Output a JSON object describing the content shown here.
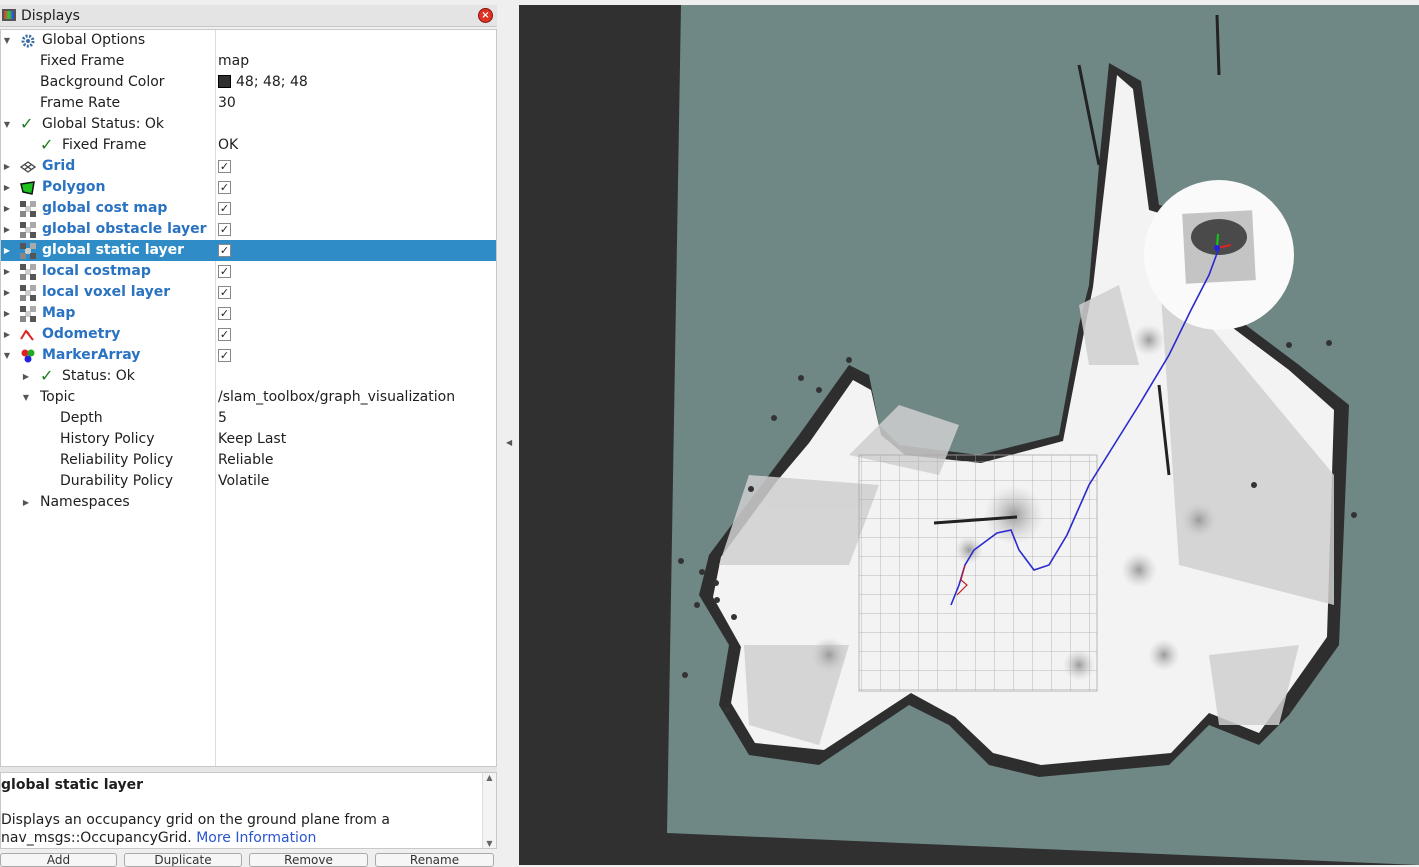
{
  "panel": {
    "title": "Displays",
    "close_label": "×"
  },
  "tree": {
    "global_options": {
      "label": "Global Options",
      "fixed_frame": {
        "label": "Fixed Frame",
        "value": "map"
      },
      "background_color": {
        "label": "Background Color",
        "value": "48; 48; 48",
        "color": "#303030"
      },
      "frame_rate": {
        "label": "Frame Rate",
        "value": "30"
      }
    },
    "global_status": {
      "label": "Global Status: Ok",
      "fixed_frame": {
        "label": "Fixed Frame",
        "value": "OK"
      }
    },
    "displays": [
      {
        "label": "Grid",
        "checked": true,
        "icon": "grid-icon"
      },
      {
        "label": "Polygon",
        "checked": true,
        "icon": "polygon-icon"
      },
      {
        "label": "global cost map",
        "checked": true,
        "icon": "map-icon"
      },
      {
        "label": "global obstacle layer",
        "checked": true,
        "icon": "map-icon"
      },
      {
        "label": "global static layer",
        "checked": true,
        "icon": "map-icon",
        "selected": true
      },
      {
        "label": "local costmap",
        "checked": true,
        "icon": "map-icon"
      },
      {
        "label": "local voxel layer",
        "checked": true,
        "icon": "map-icon"
      },
      {
        "label": "Map",
        "checked": true,
        "icon": "map-icon"
      },
      {
        "label": "Odometry",
        "checked": true,
        "icon": "odometry-icon"
      },
      {
        "label": "MarkerArray",
        "checked": true,
        "icon": "marker-array-icon"
      }
    ],
    "marker_array": {
      "status": "Status: Ok",
      "topic": {
        "label": "Topic",
        "value": "/slam_toolbox/graph_visualization"
      },
      "depth": {
        "label": "Depth",
        "value": "5"
      },
      "history_policy": {
        "label": "History Policy",
        "value": "Keep Last"
      },
      "reliability_policy": {
        "label": "Reliability Policy",
        "value": "Reliable"
      },
      "durability_policy": {
        "label": "Durability Policy",
        "value": "Volatile"
      },
      "namespaces": {
        "label": "Namespaces"
      }
    }
  },
  "description": {
    "title": "global static layer",
    "text": "Displays an occupancy grid on the ground plane from a nav_msgs::OccupancyGrid.",
    "link": "More Information"
  },
  "buttons": [
    "Add",
    "Duplicate",
    "Remove",
    "Rename"
  ],
  "colors": {
    "selection": "#308cc6",
    "display_label": "#2a72c2",
    "viewport_bg": "#303030",
    "map_unknown": "#6f8785",
    "map_free": "#f2f2f2",
    "path": "#2a2ad0"
  }
}
